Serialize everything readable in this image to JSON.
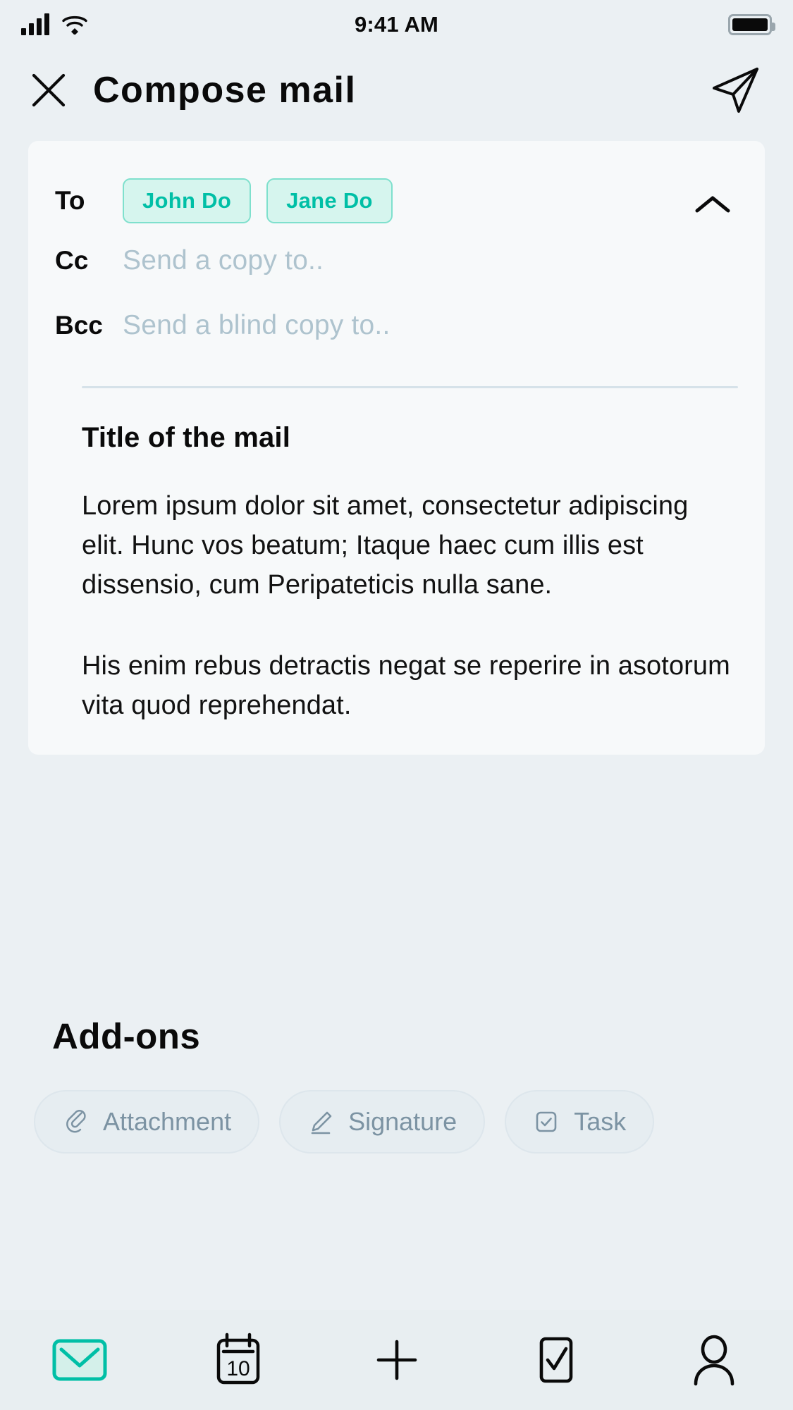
{
  "statusbar": {
    "time": "9:41 AM",
    "signal_icon": "cellular-signal-icon",
    "wifi_icon": "wifi-icon",
    "battery_icon": "battery-icon"
  },
  "header": {
    "close_icon": "close-icon",
    "title": "Compose mail",
    "send_icon": "send-paper-plane-icon"
  },
  "compose": {
    "to": {
      "label": "To",
      "chips": [
        "John Do",
        "Jane Do"
      ],
      "collapse_icon": "chevron-up-icon"
    },
    "cc": {
      "label": "Cc",
      "placeholder": "Send a copy to.."
    },
    "bcc": {
      "label": "Bcc",
      "placeholder": "Send a blind copy to.."
    },
    "subject": "Title of the mail",
    "body": [
      "Lorem ipsum dolor sit amet, consectetur adipiscing elit. Hunc vos beatum; Itaque haec cum illis est dissensio, cum Peripateticis nulla sane.",
      "His enim rebus detractis negat se reperire in asotorum vita quod reprehendat."
    ]
  },
  "addons": {
    "title": "Add-ons",
    "items": [
      {
        "label": "Attachment",
        "icon": "paperclip-icon"
      },
      {
        "label": "Signature",
        "icon": "pen-icon"
      },
      {
        "label": "Task",
        "icon": "checkbox-check-icon"
      }
    ]
  },
  "bottomnav": {
    "items": [
      {
        "name": "mail",
        "icon": "mail-envelope-icon",
        "active": true
      },
      {
        "name": "calendar",
        "icon": "calendar-icon",
        "day": "10",
        "active": false
      },
      {
        "name": "compose",
        "icon": "plus-icon",
        "active": false
      },
      {
        "name": "tasks",
        "icon": "checkbox-icon",
        "active": false
      },
      {
        "name": "profile",
        "icon": "person-icon",
        "active": false
      }
    ]
  },
  "colors": {
    "page_bg": "#ebf0f3",
    "card_bg": "#f7f9fa",
    "accent_teal": "#00bfa6",
    "chip_fill": "#d6f5ee",
    "placeholder": "#aec3ce",
    "addon_text": "#7c93a3"
  }
}
